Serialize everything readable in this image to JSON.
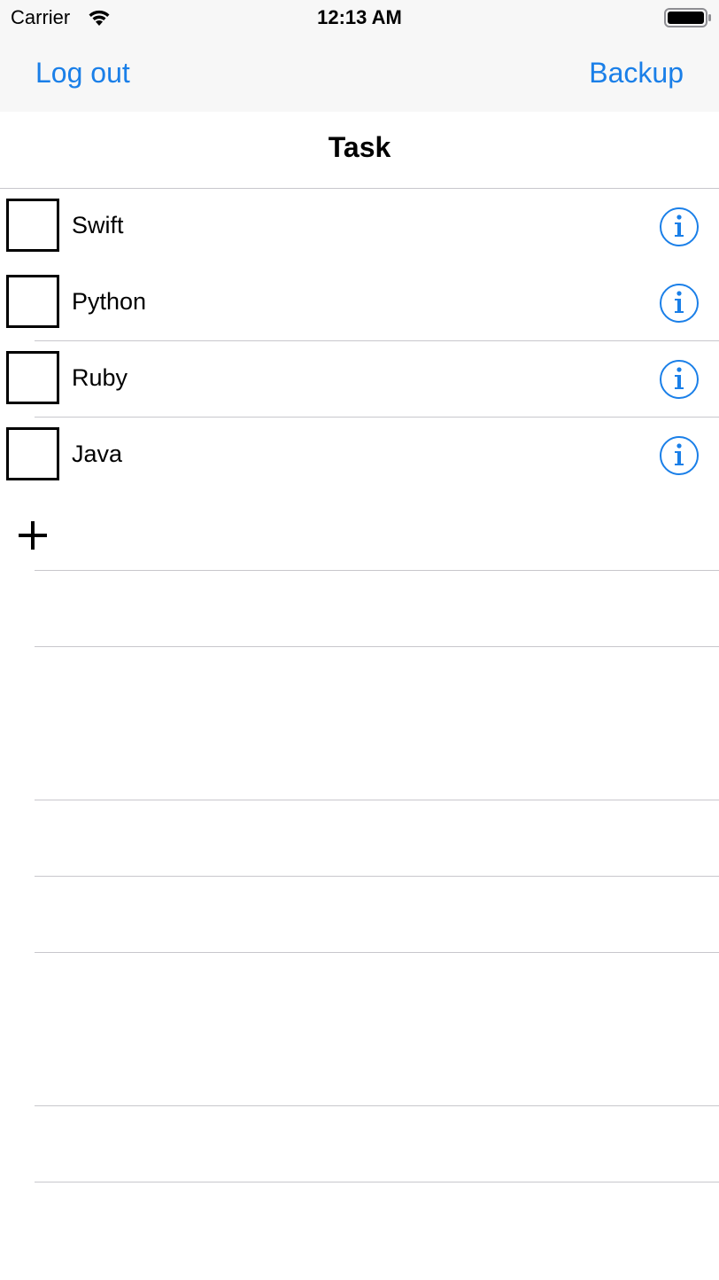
{
  "status_bar": {
    "carrier": "Carrier",
    "time": "12:13 AM",
    "wifi_icon": "wifi-icon",
    "battery_icon": "battery-icon"
  },
  "nav": {
    "left_button": "Log out",
    "right_button": "Backup",
    "accent_color": "#1a7fe8"
  },
  "header": {
    "title": "Task"
  },
  "tasks": [
    {
      "label": "Swift",
      "checked": false
    },
    {
      "label": "Python",
      "checked": false
    },
    {
      "label": "Ruby",
      "checked": false
    },
    {
      "label": "Java",
      "checked": false
    }
  ],
  "add_button_icon": "plus-icon",
  "info_icon": "info-icon"
}
